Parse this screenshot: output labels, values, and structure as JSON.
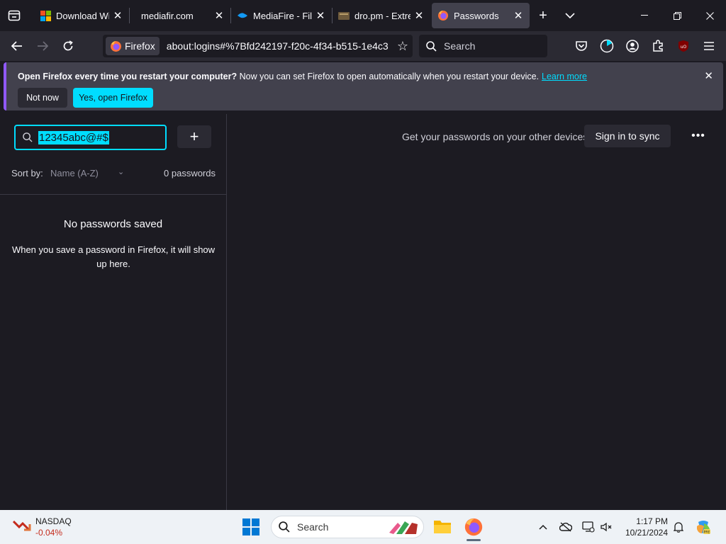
{
  "tabs": [
    {
      "title": "Download Wind",
      "favicon": "windows-icon",
      "selected": false
    },
    {
      "title": "mediafir.com",
      "favicon": "none",
      "selected": false
    },
    {
      "title": "MediaFire - File",
      "favicon": "mediafire-icon",
      "selected": false
    },
    {
      "title": "dro.pm - Extrem",
      "favicon": "dro-pm-icon",
      "selected": false
    },
    {
      "title": "Passwords",
      "favicon": "firefox-icon",
      "selected": true
    }
  ],
  "navbar": {
    "identity_label": "Firefox",
    "url": "about:logins#%7Bfd242197-f20c-4f34-b515-1e4c3",
    "search_placeholder": "Search"
  },
  "notification": {
    "bold_text": "Open Firefox every time you restart your computer?",
    "text": " Now you can set Firefox to open automatically when you restart your device.",
    "link": "Learn more",
    "not_now": "Not now",
    "yes_open": "Yes, open Firefox"
  },
  "sidebar": {
    "filter_value": "12345abc@#$",
    "add_label": "+",
    "sort_label": "Sort by:",
    "sort_value": "Name (A-Z)",
    "count": "0 passwords",
    "empty_title": "No passwords saved",
    "empty_desc": "When you save a password in Firefox, it will show up here."
  },
  "main": {
    "sync_text": "Get your passwords on your other devices",
    "sync_button": "Sign in to sync",
    "menu": "•••"
  },
  "taskbar": {
    "stock_name": "NASDAQ",
    "stock_change": "-0.04%",
    "search_label": "Search",
    "time": "1:17 PM",
    "date": "10/21/2024"
  },
  "colors": {
    "accent": "#00ddff",
    "notification_border": "#9059ff",
    "stock_down": "#c42b1c"
  }
}
